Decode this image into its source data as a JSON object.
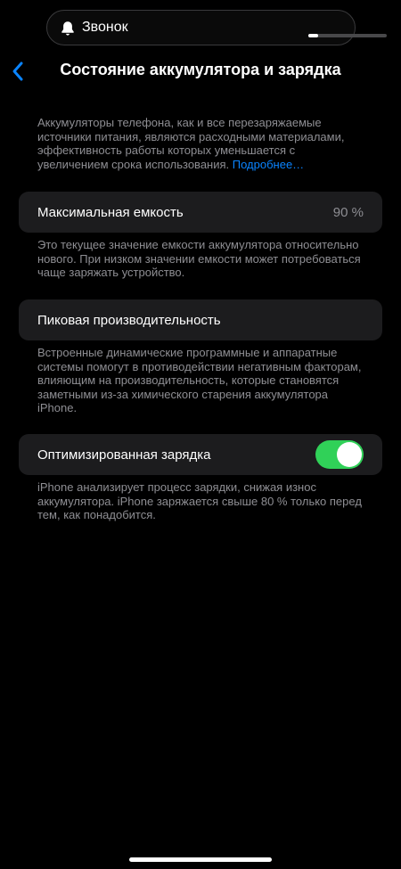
{
  "island": {
    "label": "Звонок",
    "icon": "bell-icon",
    "volume_level": 0.13
  },
  "nav": {
    "back_icon": "chevron-left-icon",
    "title": "Состояние аккумулятора и зарядка"
  },
  "intro": {
    "text": "Аккумуляторы телефона, как и все перезаряжаемые источники питания, являются расходными материалами, эффективность работы которых уменьшается с увеличением срока использования. ",
    "link": "Подробнее…"
  },
  "max_capacity": {
    "title": "Максимальная емкость",
    "value": "90 %",
    "footer": "Это текущее значение емкости аккумулятора относительно нового. При низком значении емкости может потребоваться чаще заряжать устройство."
  },
  "peak_performance": {
    "title": "Пиковая производительность",
    "footer": "Встроенные динамические программные и аппаратные системы помогут в противодействии негативным факторам, влияющим на производительность, которые становятся заметными из-за химического старения аккумулятора iPhone."
  },
  "optimized_charging": {
    "title": "Оптимизированная зарядка",
    "enabled": true,
    "footer": "iPhone анализирует процесс зарядки, снижая износ аккумулятора. iPhone заряжается свыше 80 % только перед тем, как понадобится."
  },
  "colors": {
    "background": "#000000",
    "cell": "#1c1c1e",
    "secondary_text": "#8e8e93",
    "link": "#0a84ff",
    "toggle_on": "#30d158"
  }
}
